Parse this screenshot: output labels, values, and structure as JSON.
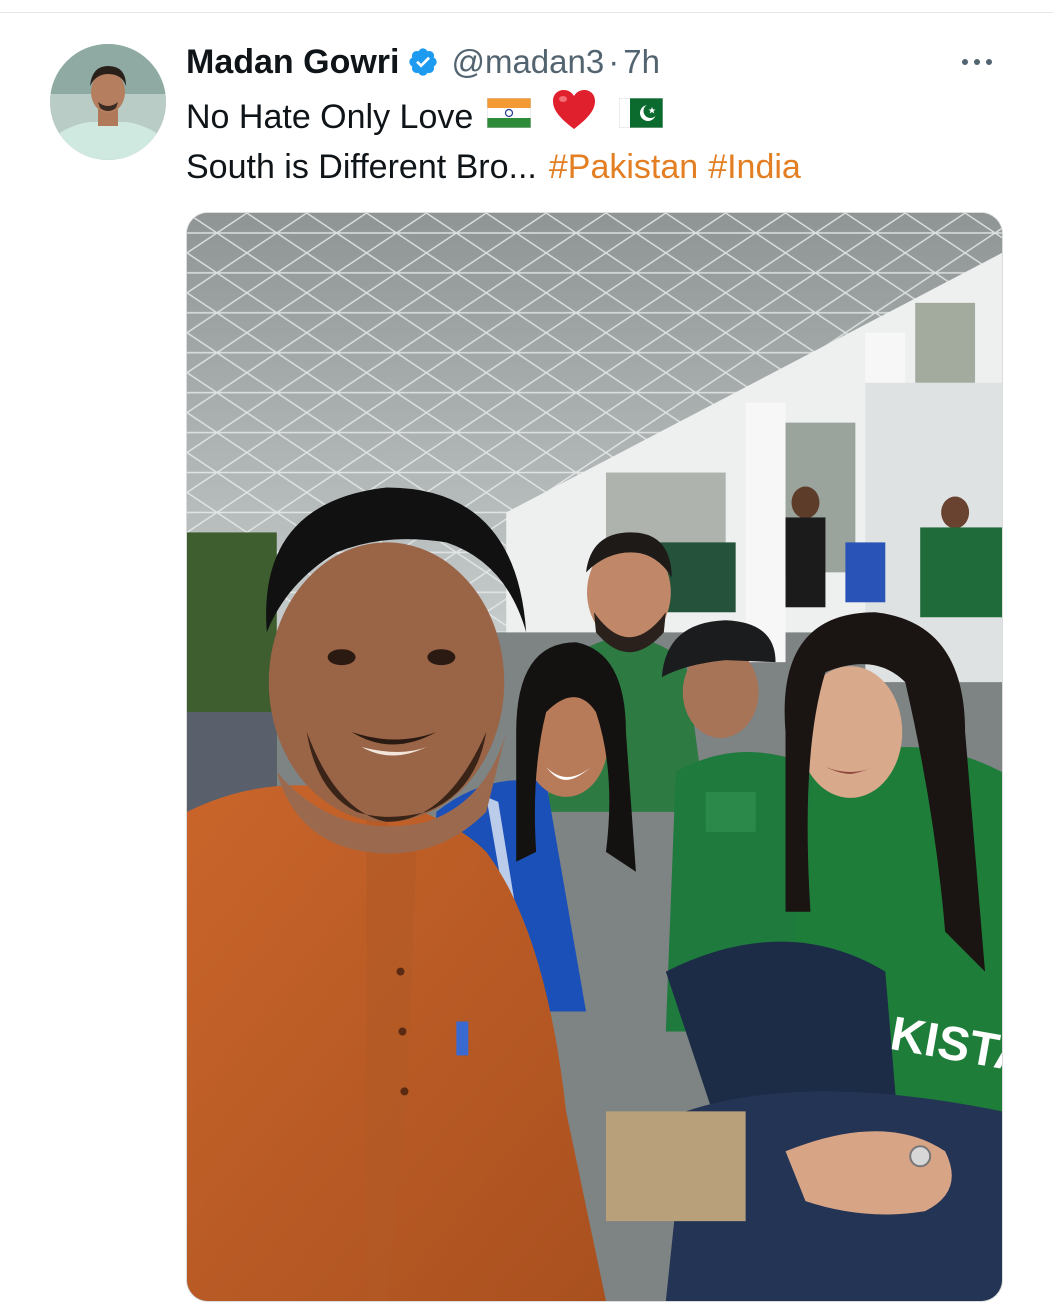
{
  "tweet": {
    "author": {
      "name": "Madan Gowri",
      "handle": "@madan3",
      "verified": true,
      "avatar_icon": "profile-avatar"
    },
    "separator": "·",
    "time": "7h",
    "text_line1": "No Hate Only Love",
    "emojis": [
      "india-flag-icon",
      "red-heart-icon",
      "pakistan-flag-icon"
    ],
    "text_line2": "South is Different Bro...",
    "hashtags": [
      "#Pakistan",
      "#India"
    ],
    "more_icon": "more-options-icon",
    "media": {
      "type": "photo",
      "jersey_text": "AKISTAN"
    }
  },
  "colors": {
    "hashtag": "#e37f22",
    "verified": "#1d9bf0",
    "secondary_text": "#536471"
  }
}
